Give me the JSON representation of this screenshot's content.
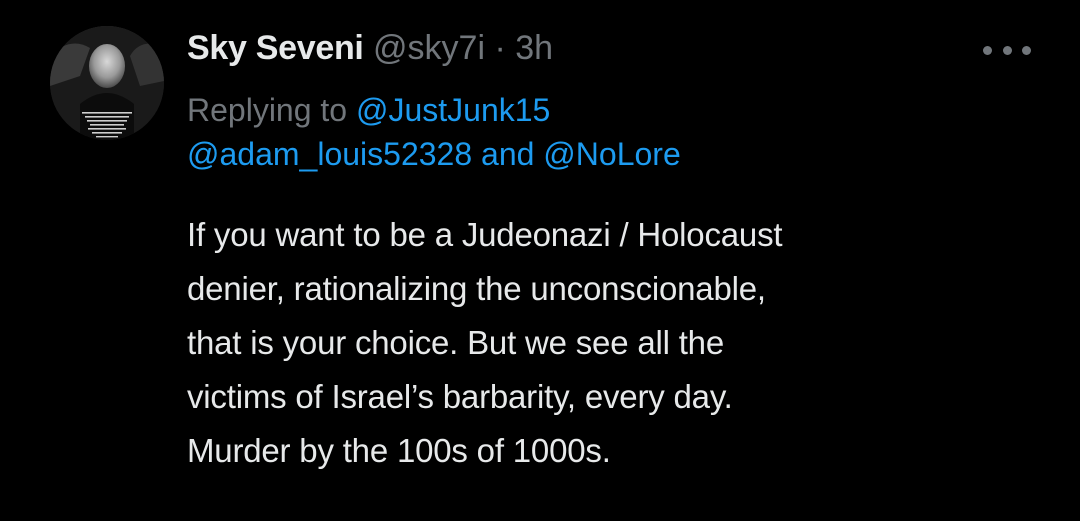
{
  "tweet": {
    "author": {
      "display_name": "Sky Seveni",
      "handle": "@sky7i",
      "separator": "·",
      "time": "3h",
      "avatar_icon": "profile-photo-avatar"
    },
    "more_icon": "more-dots-icon",
    "reply": {
      "prefix": "Replying to",
      "mentions": [
        "@JustJunk15",
        "@adam_louis52328",
        "@NoLore"
      ],
      "conjunction": "and"
    },
    "lines": [
      "If you want to be a Judeonazi / Holocaust",
      "denier, rationalizing the unconscionable,",
      "that is your choice. But we see all the",
      "victims of Israel’s barbarity, every day.",
      "Murder by the 100s of 1000s."
    ]
  },
  "colors": {
    "background": "#000000",
    "text_primary": "#e7e9ea",
    "text_secondary": "#71767b",
    "link": "#1d9bf0"
  }
}
